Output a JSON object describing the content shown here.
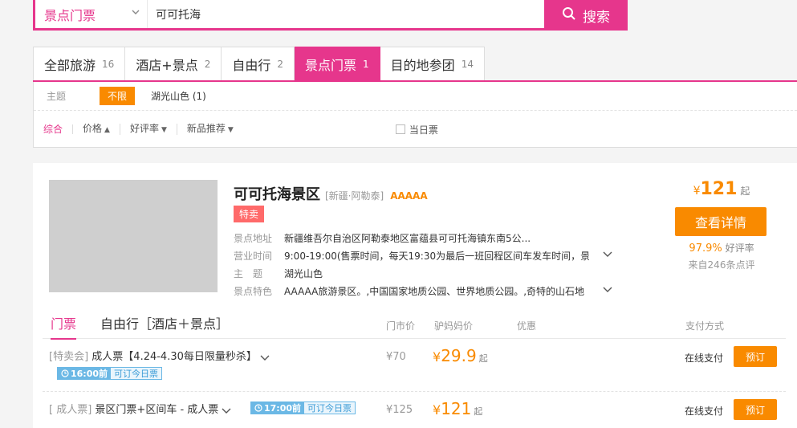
{
  "search": {
    "category": "景点门票",
    "query": "可可托海",
    "button_label": "搜索"
  },
  "tabs": [
    {
      "label": "全部旅游",
      "count": "16"
    },
    {
      "label": "酒店+景点",
      "count": "2"
    },
    {
      "label": "自由行",
      "count": "2"
    },
    {
      "label": "景点门票",
      "count": "1"
    },
    {
      "label": "目的地参团",
      "count": "14"
    }
  ],
  "filters": {
    "theme_label": "主题",
    "theme_all": "不限",
    "theme_option": "湖光山色 (1)",
    "sort": [
      {
        "label": "综合"
      },
      {
        "label": "价格",
        "arrow": "▲"
      },
      {
        "label": "好评率",
        "arrow": "▼"
      },
      {
        "label": "新品推荐",
        "arrow": "▼"
      }
    ],
    "today_label": "当日票"
  },
  "result": {
    "name": "可可托海景区",
    "region": "[新疆·阿勒泰]",
    "level": "AAAAA",
    "badge": "特卖",
    "info": [
      {
        "key": "景点地址",
        "value": "新疆维吾尔自治区阿勒泰地区富蕴县可可托海镇东南5公..."
      },
      {
        "key": "营业时间",
        "value": "9:00-19:00(售票时间，每天19:30为最后一班回程区间车发车时间，景"
      },
      {
        "key": "主　题",
        "value": "湖光山色"
      },
      {
        "key": "景点特色",
        "value": "AAAAA旅游景区。,中国国家地质公园、世界地质公园。,奇特的山石地"
      }
    ],
    "price_symbol": "¥",
    "price": "121",
    "price_suffix": "起",
    "detail_button": "查看详情",
    "rating_pct": "97.9%",
    "rating_label": "好评率",
    "reviews": "来自246条点评"
  },
  "tickets": {
    "tabs": [
      "门票",
      "自由行［酒店＋景点］"
    ],
    "columns": {
      "market": "门市价",
      "our": "驴妈妈价",
      "discount": "优惠",
      "payment": "支付方式"
    },
    "rows": [
      {
        "type": "[特卖会]",
        "name": "成人票【4.24-4.30每日限量秒杀】",
        "time": "16:00",
        "time_suffix": "前",
        "time_note": "可订今日票",
        "market": "¥70",
        "price_symbol": "¥",
        "price": "29.9",
        "price_suffix": "起",
        "payment": "在线支付",
        "book": "预订"
      },
      {
        "type": "[ 成人票]",
        "name": "景区门票+区间车 - 成人票",
        "time": "17:00",
        "time_suffix": "前",
        "time_note": "可订今日票",
        "market": "¥125",
        "price_symbol": "¥",
        "price": "121",
        "price_suffix": "起",
        "payment": "在线支付",
        "book": "预订"
      }
    ]
  },
  "colors": {
    "brand_pink": "#e6368c",
    "orange": "#f98a00",
    "blue_tag": "#6bb8e5"
  },
  "icons": [
    "chevron-down-icon",
    "search-icon",
    "sort-arrow-icon",
    "clock-icon",
    "checkbox-icon"
  ]
}
